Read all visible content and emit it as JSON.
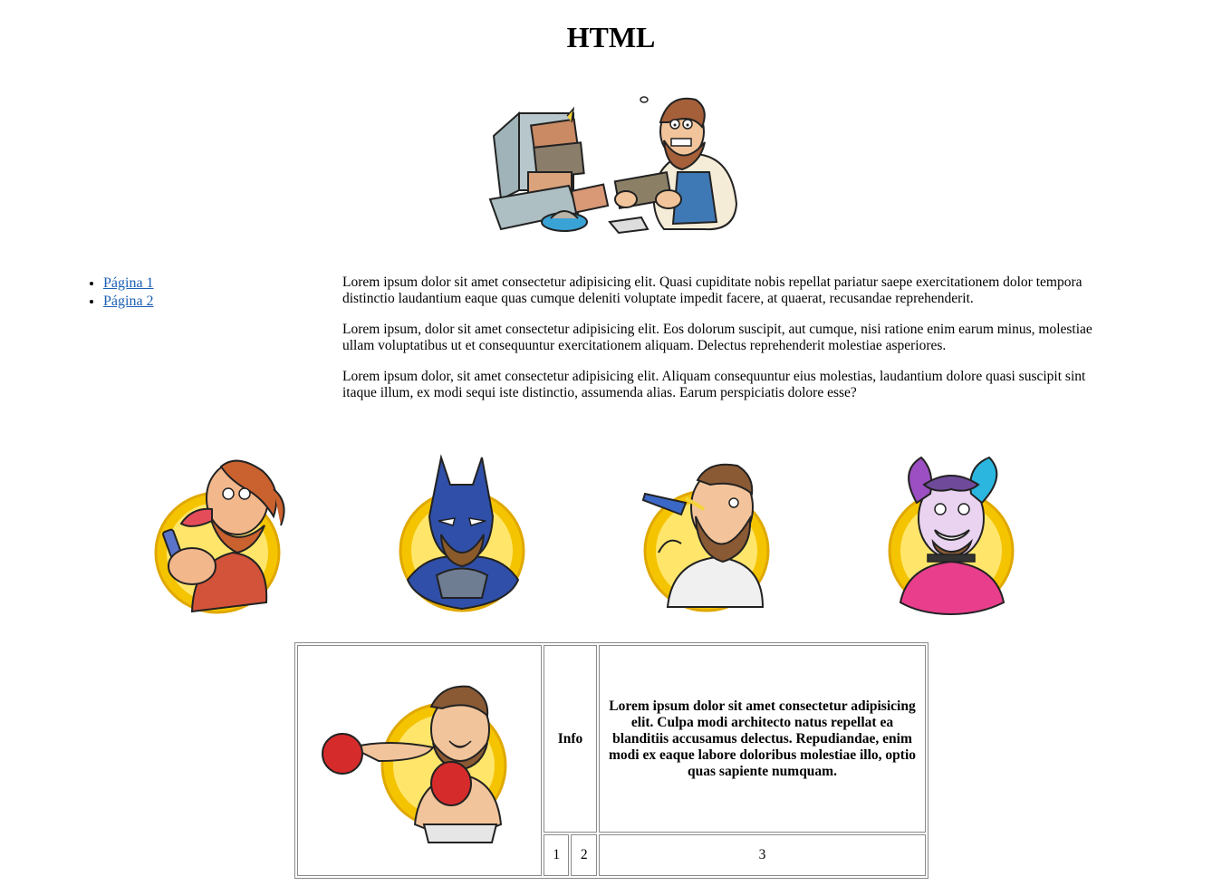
{
  "page": {
    "title": "HTML"
  },
  "nav": {
    "items": [
      {
        "label": "Página 1"
      },
      {
        "label": "Página 2"
      }
    ]
  },
  "content": {
    "paragraphs": [
      "Lorem ipsum dolor sit amet consectetur adipisicing elit. Quasi cupiditate nobis repellat pariatur saepe exercitationem dolor tempora distinctio laudantium eaque quas cumque deleniti voluptate impedit facere, at quaerat, recusandae reprehenderit.",
      "Lorem ipsum, dolor sit amet consectetur adipisicing elit. Eos dolorum suscipit, aut cumque, nisi ratione enim earum minus, molestiae ullam voluptatibus ut et consequuntur exercitationem aliquam. Delectus reprehenderit molestiae asperiores.",
      "Lorem ipsum dolor, sit amet consectetur adipisicing elit. Aliquam consequuntur eius molestias, laudantium dolore quasi suscipit sint itaque illum, ex modi sequi iste distinctio, assumenda alias. Earum perspiciatis dolore esse?"
    ]
  },
  "table": {
    "header_info": "Info",
    "header_text": "Lorem ipsum dolor sit amet consectetur adipisicing elit. Culpa modi architecto natus repellat ea blanditiis accusamus delectus. Repudiandae, enim modi ex eaque labore doloribus molestiae illo, optio quas sapiente numquam.",
    "cells": [
      "1",
      "2",
      "3"
    ]
  },
  "colors": {
    "badge_gold": "#f5c400",
    "badge_light": "#ffe66b",
    "link": "#1a5fb4"
  }
}
